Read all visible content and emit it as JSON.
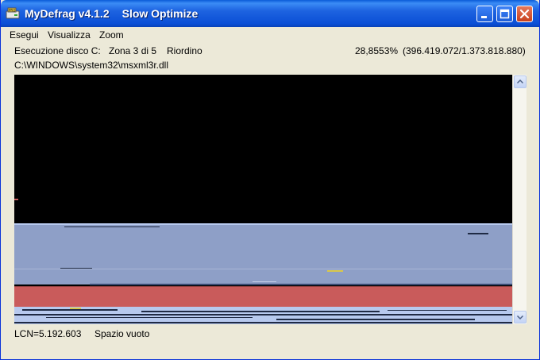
{
  "window": {
    "title": "MyDefrag v4.1.2",
    "subtitle": "Slow Optimize",
    "app_icon": "defrag-disk-icon",
    "controls": [
      "minimize-icon",
      "maximize-icon",
      "close-icon"
    ]
  },
  "menu": {
    "items": [
      "Esegui",
      "Visualizza",
      "Zoom"
    ]
  },
  "status": {
    "execution": "Esecuzione disco C:",
    "zone": "Zona 3 di 5",
    "phase": "Riordino",
    "percent": "28,8553%",
    "progress": "(396.419.072/1.373.818.880)",
    "current_file": "C:\\WINDOWS\\system32\\msxml3r.dll"
  },
  "bottom": {
    "lcn": "LCN=5.192.603",
    "cluster_state": "Spazio vuoto"
  },
  "colors": {
    "title_bar": "#0b4fd6",
    "free_space": "#000000",
    "used_space": "#8e9fc7",
    "mft_zone": "#c95b5b",
    "unmovable": "#b7c9ee",
    "marker": "#d9c84a"
  }
}
